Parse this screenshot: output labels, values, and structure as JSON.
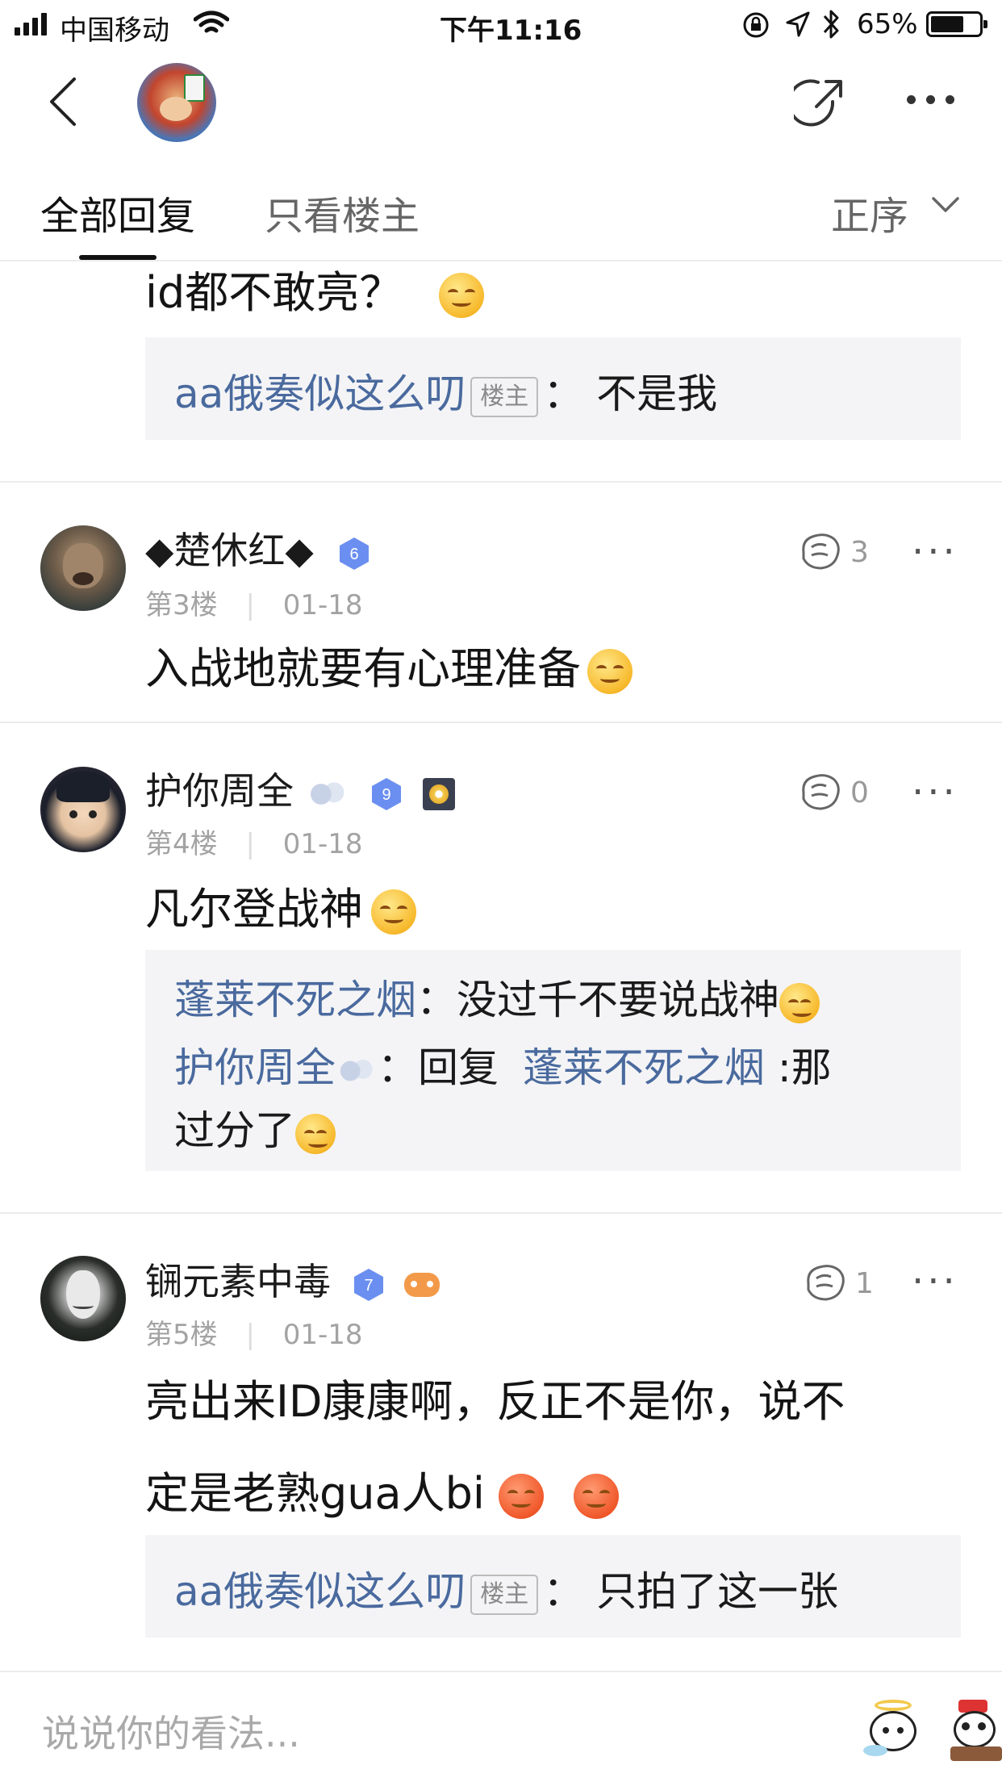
{
  "status_bar": {
    "carrier": "中国移动",
    "time": "下午11:16",
    "battery": "65%"
  },
  "tabs": {
    "all_replies": "全部回复",
    "op_only": "只看楼主",
    "sort": "正序"
  },
  "partial_post": {
    "body": "id都不敢亮？",
    "reply": {
      "author": "aa俄奏似这么叨",
      "badge": "楼主",
      "text": "不是我"
    }
  },
  "posts": [
    {
      "username": "◆楚休红◆",
      "level": "6",
      "floor": "第3楼",
      "date": "01-18",
      "likes": "3",
      "body": "入战地就要有心理准备"
    },
    {
      "username": "护你周全",
      "level": "9",
      "floor": "第4楼",
      "date": "01-18",
      "likes": "0",
      "body": "凡尔登战神",
      "replies": [
        {
          "author": "蓬莱不死之烟",
          "sep": "：",
          "text": "没过千不要说战神"
        },
        {
          "author": "护你周全",
          "sep": "：",
          "prefix": "回复",
          "target": "蓬莱不死之烟",
          "text": ":那",
          "text2": "过分了"
        }
      ]
    },
    {
      "username": "锎元素中毒",
      "level": "7",
      "floor": "第5楼",
      "date": "01-18",
      "likes": "1",
      "body_line1": "亮出来ID康康啊，反正不是你，说不",
      "body_line2": "定是老熟gua人bi",
      "reply": {
        "author": "aa俄奏似这么叨",
        "badge": "楼主",
        "text": "只拍了这一张"
      }
    }
  ],
  "input": {
    "placeholder": "说说你的看法..."
  },
  "colors": {
    "link_blue": "#4a6a9e",
    "meta_gray": "#a3a3a3",
    "reply_bg": "#f4f4f6",
    "badge_blue": "#6b8ff0"
  }
}
